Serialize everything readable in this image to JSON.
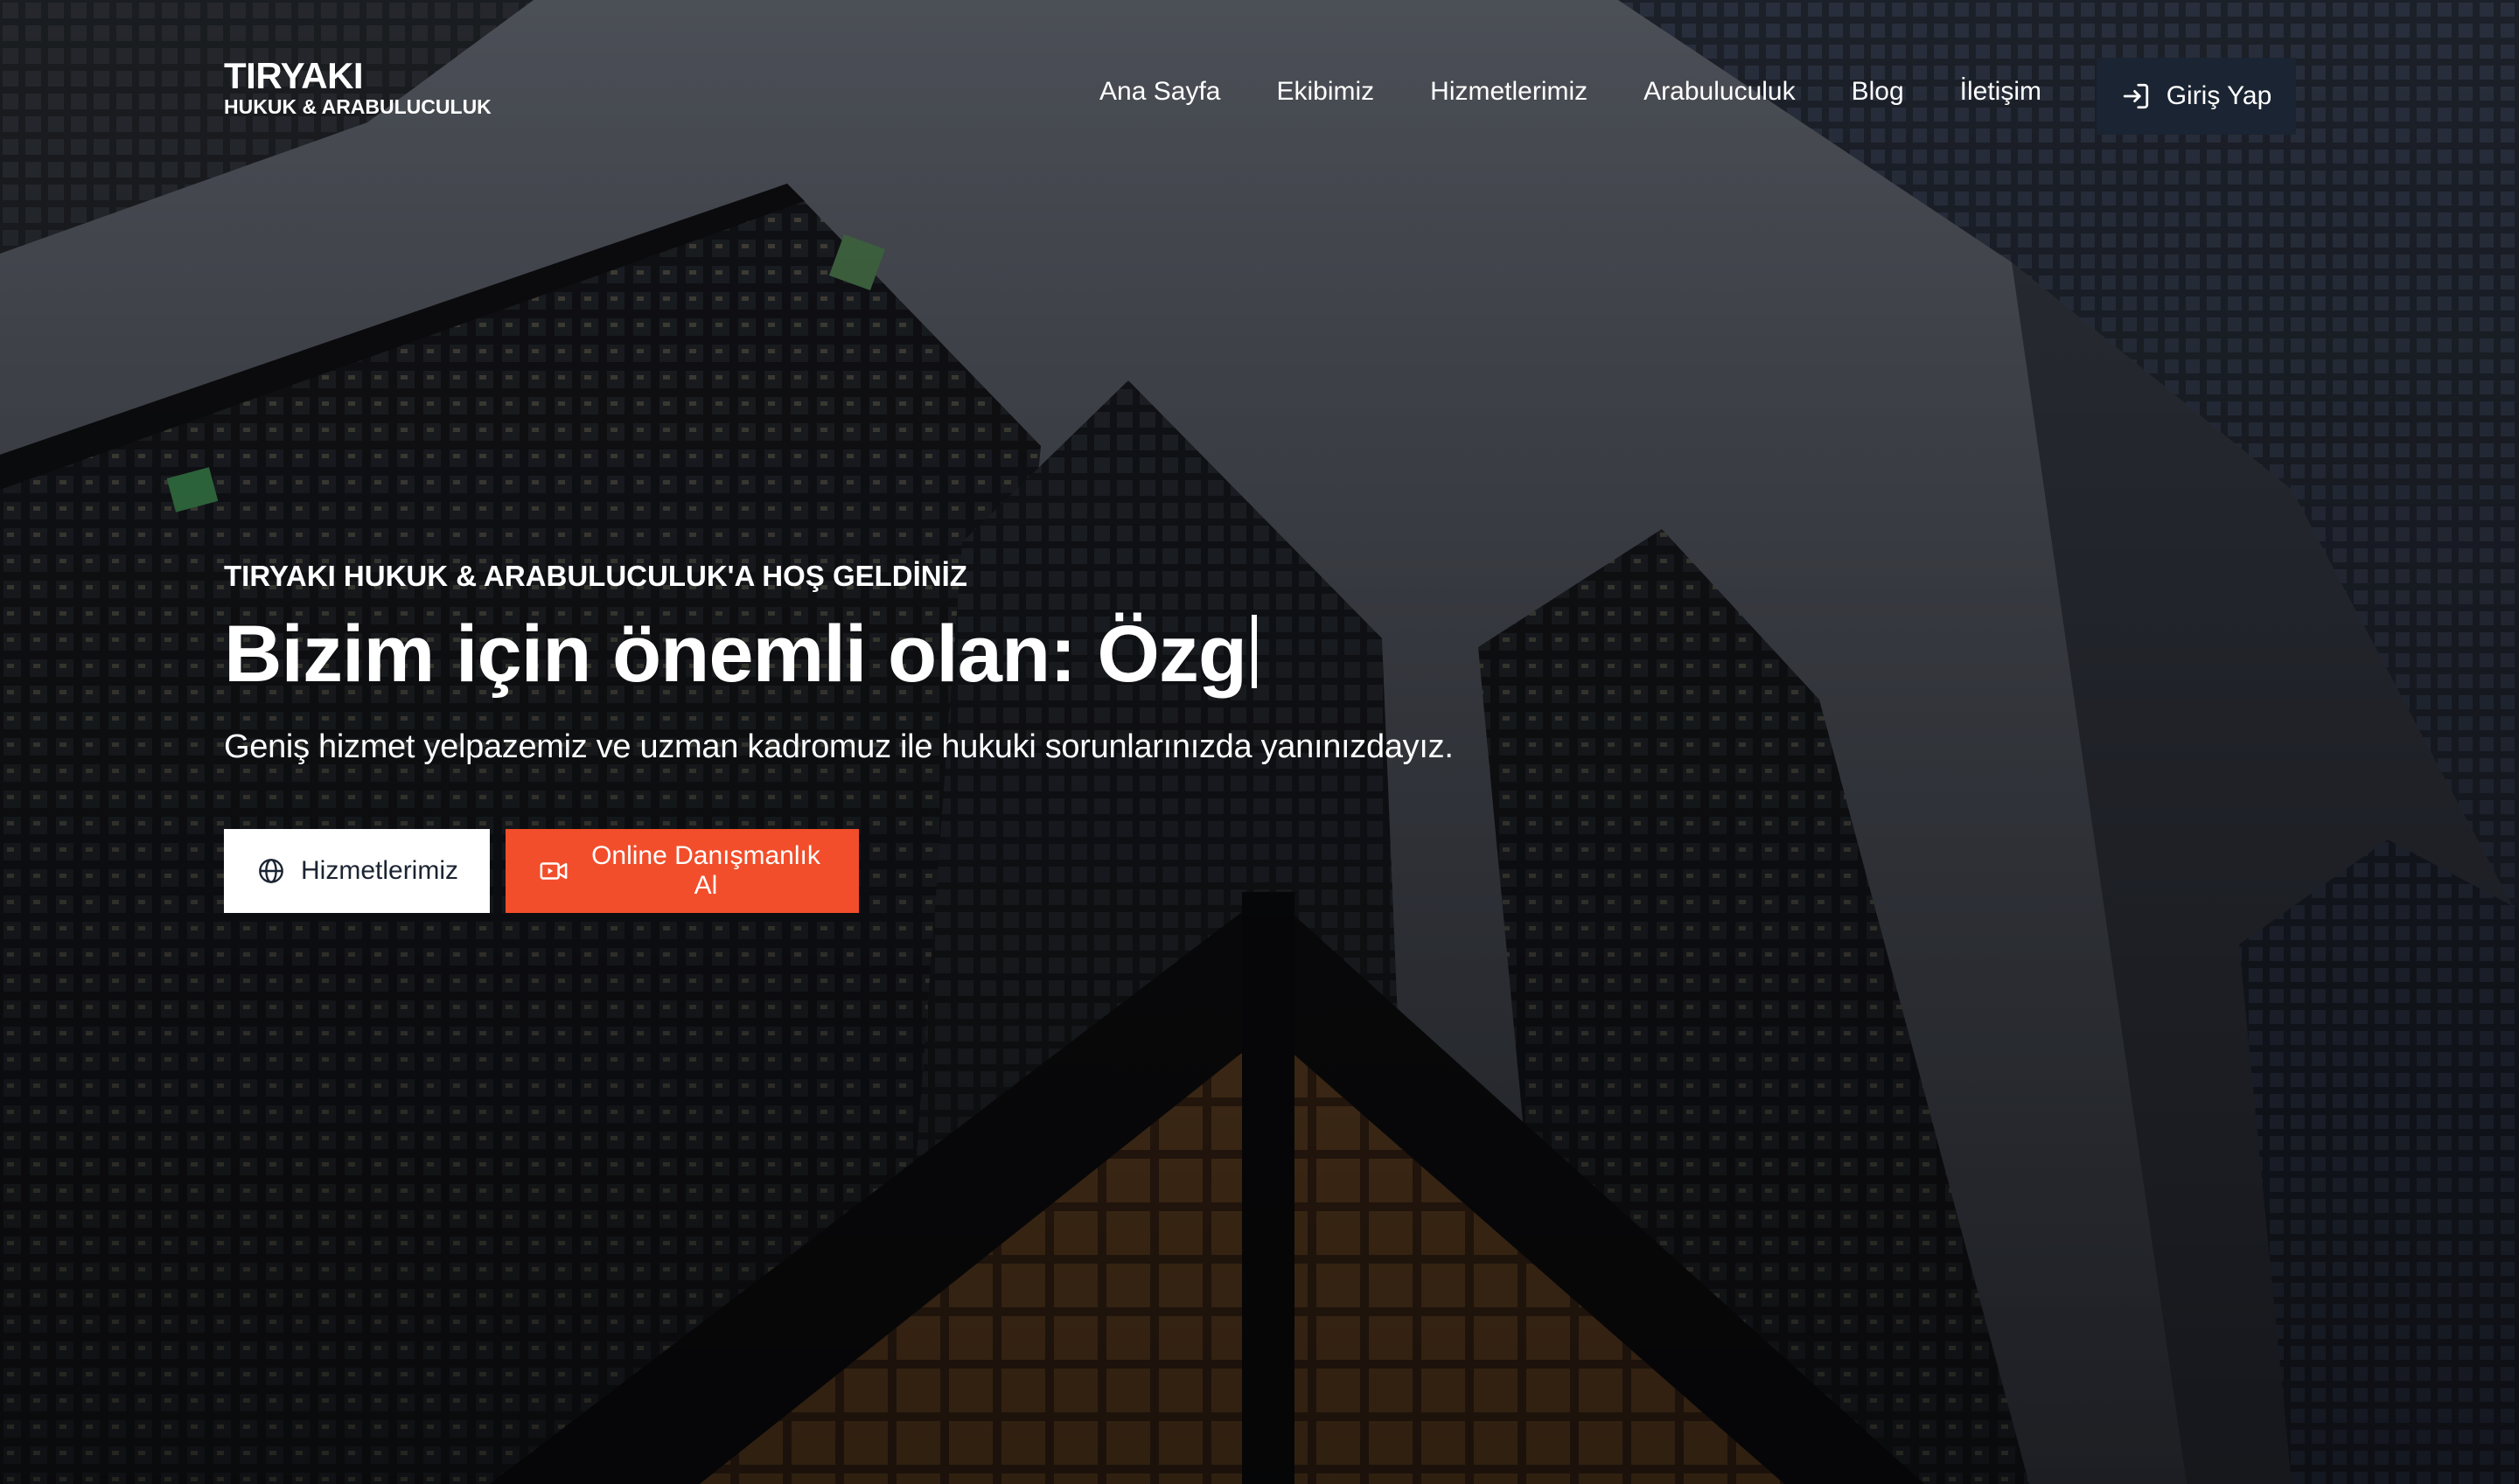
{
  "brand": {
    "title": "TIRYAKI",
    "subtitle": "HUKUK & ARABULUCULUK"
  },
  "nav": {
    "items": [
      {
        "label": "Ana Sayfa"
      },
      {
        "label": "Ekibimiz"
      },
      {
        "label": "Hizmetlerimiz"
      },
      {
        "label": "Arabuluculuk"
      },
      {
        "label": "Blog"
      },
      {
        "label": "İletişim"
      }
    ],
    "login_label": "Giriş Yap",
    "login_icon": "login-icon"
  },
  "hero": {
    "eyebrow": "TIRYAKI HUKUK & ARABULUCULUK'A HOŞ GELDİNİZ",
    "headline": "Bizim için önemli olan: Özg",
    "subtext": "Geniş hizmet yelpazemiz ve uzman kadromuz ile hukuki sorunlarınızda yanınızdayız.",
    "buttons": {
      "services_label": "Hizmetlerimiz",
      "services_icon": "globe-icon",
      "consult_label": "Online Danışmanlık Al",
      "consult_icon": "video-camera-icon"
    }
  },
  "colors": {
    "nav_button_bg": "#1b2432",
    "accent": "#f24e2b",
    "text": "#ffffff"
  }
}
